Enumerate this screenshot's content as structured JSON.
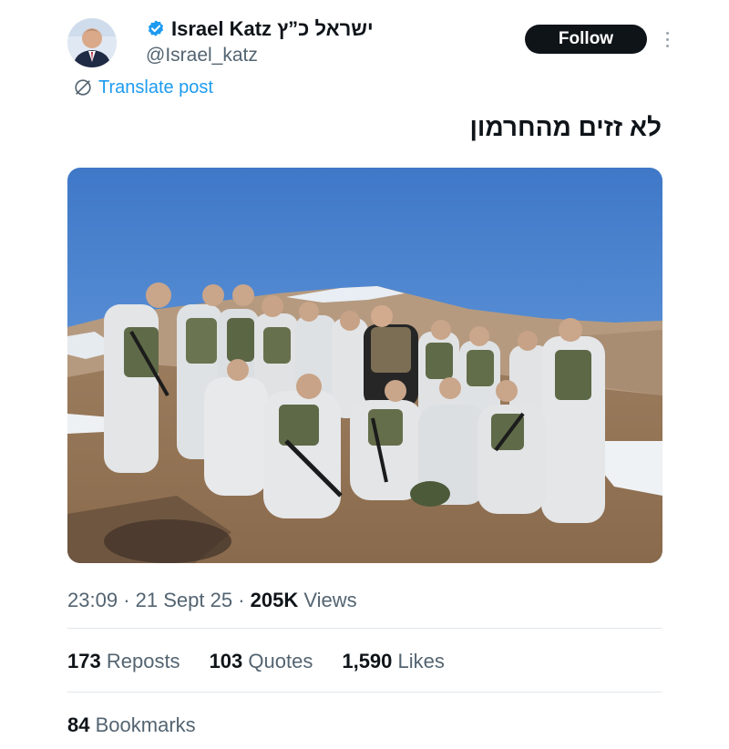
{
  "author": {
    "name": "Israel Katz",
    "name_hebrew": "ישראל כ”ץ",
    "handle": "@Israel_katz",
    "verified": true,
    "avatar_icon": "profile-photo"
  },
  "actions": {
    "follow_label": "Follow",
    "more_icon": "vertical-ellipsis-icon"
  },
  "translate": {
    "label": "Translate post",
    "icon": "translate-globe-icon"
  },
  "post": {
    "text": "לא זזים מהחרמון",
    "image_icon": "group-photo-soldiers-on-mountain"
  },
  "meta": {
    "time": "23:09",
    "separator": "·",
    "date": "21 Sept 25",
    "views_count": "205K",
    "views_label": "Views"
  },
  "stats": {
    "reposts_count": "173",
    "reposts_label": "Reposts",
    "quotes_count": "103",
    "quotes_label": "Quotes",
    "likes_count": "1,590",
    "likes_label": "Likes",
    "bookmarks_count": "84",
    "bookmarks_label": "Bookmarks"
  },
  "colors": {
    "accent": "#1d9bf0",
    "text_primary": "#0f1419",
    "text_secondary": "#536471",
    "button_bg": "#0f1419",
    "divider": "#e1e6ea"
  }
}
